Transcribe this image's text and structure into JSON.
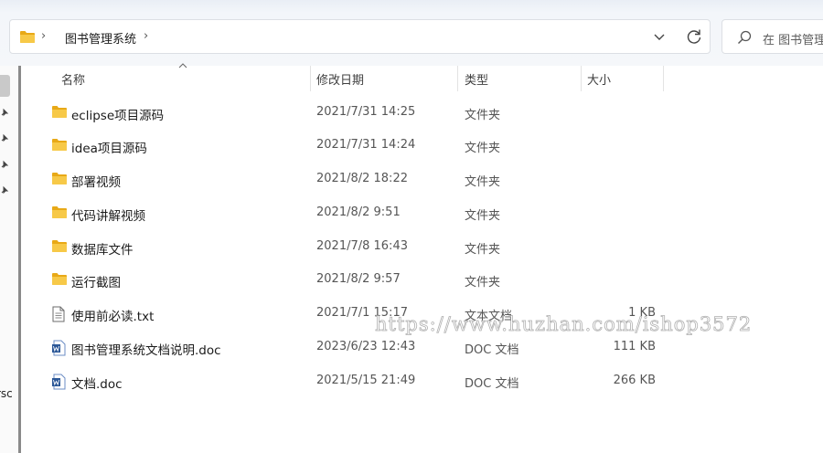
{
  "address": {
    "path": [
      "图书管理系统"
    ]
  },
  "search": {
    "placeholder": "在 图书管理"
  },
  "columns": {
    "name": "名称",
    "modified": "修改日期",
    "type": "类型",
    "size": "大小"
  },
  "files": [
    {
      "name": "eclipse项目源码",
      "date": "2021/7/31 14:25",
      "type": "文件夹",
      "size": "",
      "icon": "folder-icon"
    },
    {
      "name": "idea项目源码",
      "date": "2021/7/31 14:24",
      "type": "文件夹",
      "size": "",
      "icon": "folder-icon"
    },
    {
      "name": "部署视频",
      "date": "2021/8/2 18:22",
      "type": "文件夹",
      "size": "",
      "icon": "folder-icon"
    },
    {
      "name": "代码讲解视频",
      "date": "2021/8/2 9:51",
      "type": "文件夹",
      "size": "",
      "icon": "folder-icon"
    },
    {
      "name": "数据库文件",
      "date": "2021/7/8 16:43",
      "type": "文件夹",
      "size": "",
      "icon": "folder-icon"
    },
    {
      "name": "运行截图",
      "date": "2021/8/2 9:57",
      "type": "文件夹",
      "size": "",
      "icon": "folder-icon"
    },
    {
      "name": "使用前必读.txt",
      "date": "2021/7/1 15:17",
      "type": "文本文档",
      "size": "1 KB",
      "icon": "text-file-icon"
    },
    {
      "name": "图书管理系统文档说明.doc",
      "date": "2023/6/23 12:43",
      "type": "DOC 文档",
      "size": "111 KB",
      "icon": "word-doc-icon"
    },
    {
      "name": "文档.doc",
      "date": "2021/5/15 21:49",
      "type": "DOC 文档",
      "size": "266 KB",
      "icon": "word-doc-icon"
    }
  ],
  "nav_partial_text": "rsc",
  "watermark": "https://www.huzhan.com/ishop3572",
  "colors": {
    "folder": "#f7c948",
    "folder_dark": "#e8a917",
    "word_blue": "#2b5797"
  }
}
